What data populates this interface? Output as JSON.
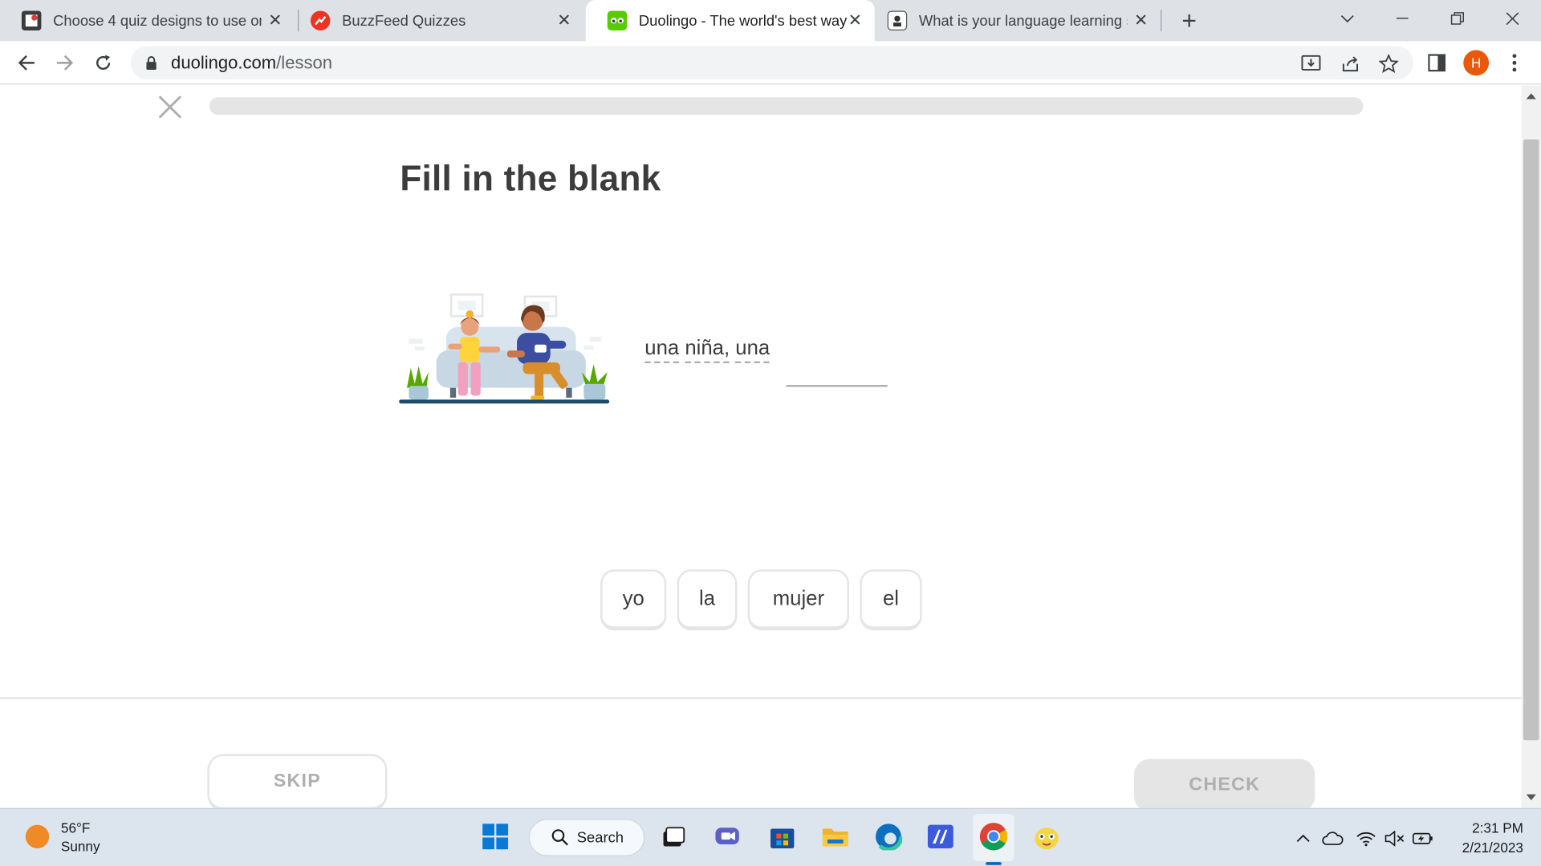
{
  "browser": {
    "tabs": [
      {
        "title": "Choose 4 quiz designs to use on",
        "active": false
      },
      {
        "title": "BuzzFeed Quizzes",
        "active": false
      },
      {
        "title": "Duolingo - The world's best way",
        "active": true
      },
      {
        "title": "What is your language learning s",
        "active": false
      }
    ],
    "address": {
      "domain": "duolingo.com",
      "path": "/lesson"
    },
    "profile_initial": "H"
  },
  "lesson": {
    "progress": 0,
    "heading": "Fill in the blank",
    "prompt_words": [
      "una",
      "niña,",
      "una"
    ],
    "word_bank": [
      "yo",
      "la",
      "mujer",
      "el"
    ],
    "skip_label": "SKIP",
    "check_label": "CHECK"
  },
  "taskbar": {
    "weather_temp": "56°F",
    "weather_desc": "Sunny",
    "search_label": "Search",
    "time": "2:31 PM",
    "date": "2/21/2023"
  },
  "colors": {
    "accent": "#58cc02",
    "disabled": "#e5e5e5",
    "text": "#3c3c3c"
  }
}
